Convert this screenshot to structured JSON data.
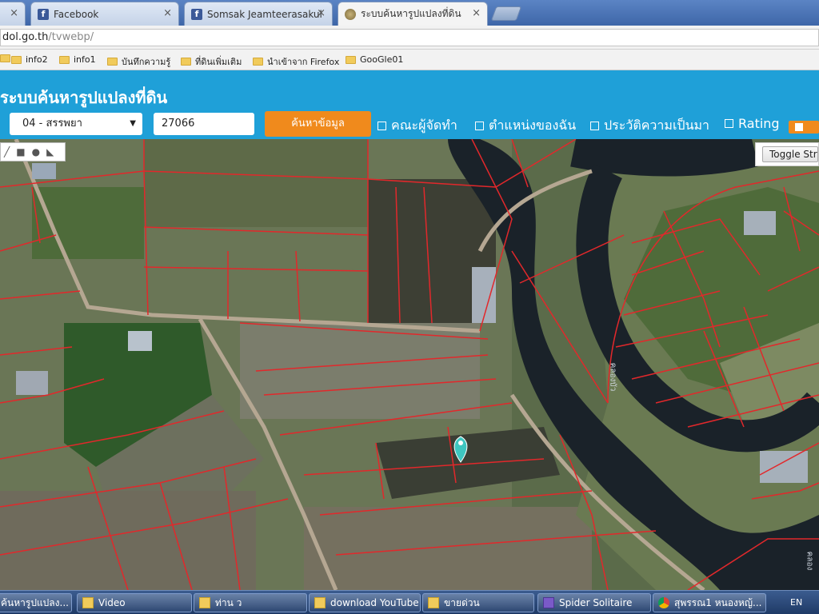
{
  "browser": {
    "tabs": [
      {
        "label": "",
        "icon": "none"
      },
      {
        "label": "Facebook",
        "icon": "facebook-icon"
      },
      {
        "label": "Somsak Jeamteerasakul",
        "icon": "facebook-icon"
      },
      {
        "label": "ระบบค้นหารูปแปลงที่ดิน",
        "icon": "globe-icon"
      }
    ],
    "close_glyph": "×",
    "url_host": "dol.go.th",
    "url_path": "/tvwebp/",
    "bookmarks": [
      "info2",
      "info1",
      "บันทึกความรู้",
      "ที่ดินเพิ่มเติม",
      "นำเข้าจาก Firefox",
      "GooGle01"
    ]
  },
  "page": {
    "title": "ระบบค้นหารูปแปลงที่ดิน",
    "province_select": "04 - สรรพยา",
    "parcel_input": "27066",
    "search_button": "ค้นหาข้อมูล",
    "options": [
      "คณะผู้จัดทำ",
      "ตำแหน่งของฉัน",
      "ประวัติความเป็นมา",
      "Rating"
    ]
  },
  "map": {
    "toggle_button": "Toggle Street",
    "river_label": "คลองบัว",
    "river_label_2": "คลอง",
    "draw_tools": [
      "pencil-icon",
      "rectangle-icon",
      "circle-icon",
      "polygon-icon"
    ],
    "marker_color": "#3ec6c0",
    "parcel_line_color": "#e2282b"
  },
  "taskbar": {
    "items": [
      {
        "label": "ค้นหารูปแปลง...",
        "icon": "chrome-icon"
      },
      {
        "label": "Video",
        "icon": "folder-icon"
      },
      {
        "label": "ท่าน ว",
        "icon": "folder-icon"
      },
      {
        "label": "download YouTube",
        "icon": "folder-icon"
      },
      {
        "label": "ขายด่วน",
        "icon": "folder-icon"
      },
      {
        "label": "Spider Solitaire",
        "icon": "spider-icon"
      },
      {
        "label": "สุพรรณ1 หนองหญ้...",
        "icon": "chrome-icon"
      }
    ],
    "language": "EN"
  }
}
